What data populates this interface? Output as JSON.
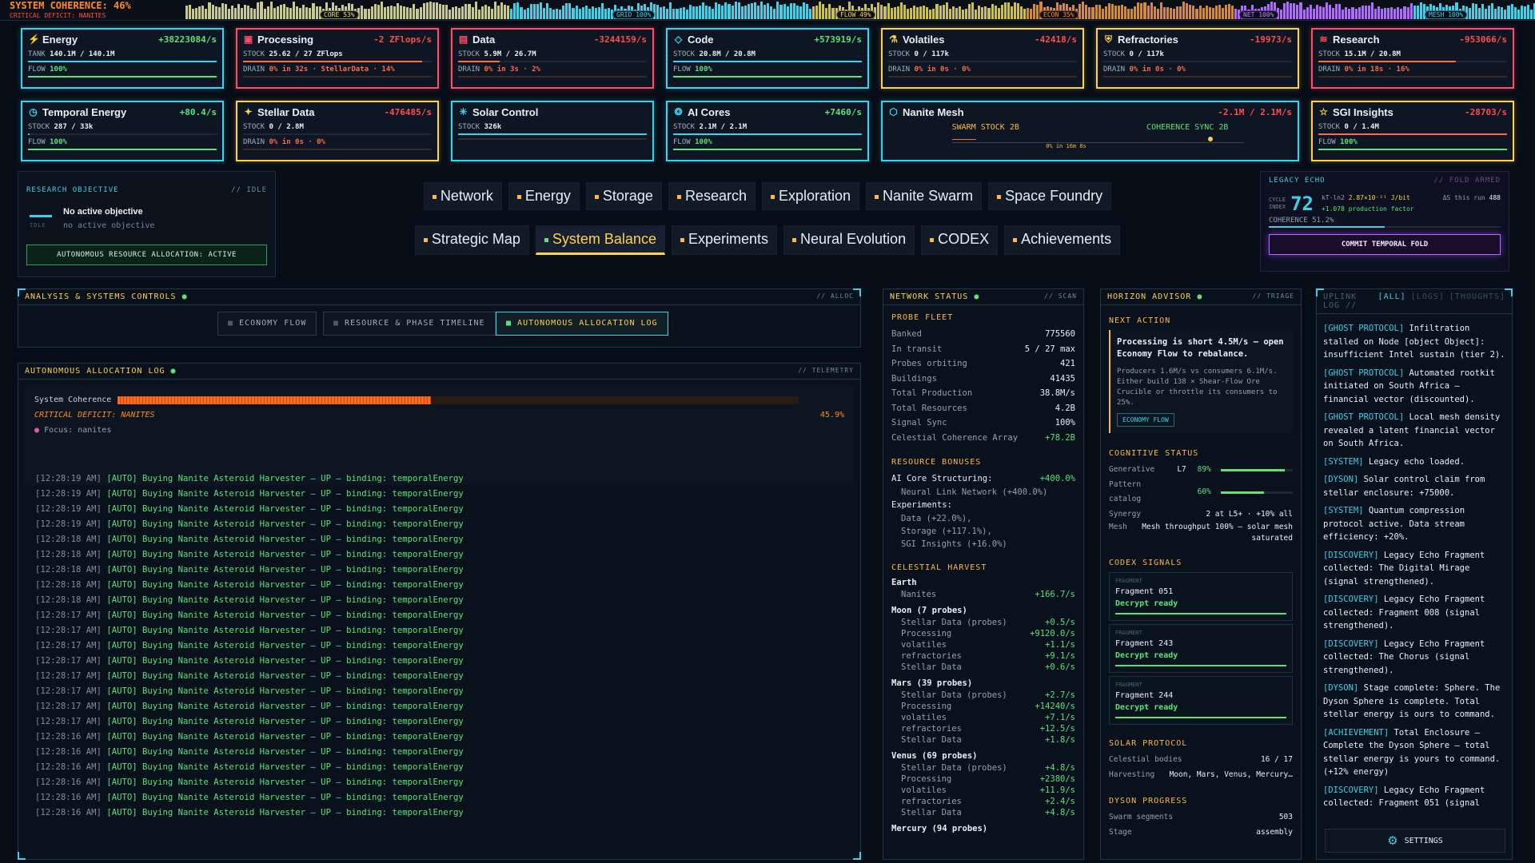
{
  "topbar": {
    "coherence": "SYSTEM COHERENCE: 46%",
    "critical": "CRITICAL DEFICIT: NANITES",
    "segments": [
      "CORE 53%",
      "GRID 100%",
      "FLOW 49%",
      "ECON 35%",
      "NET 100%",
      "MESH 100%"
    ]
  },
  "resources": [
    {
      "name": "Energy",
      "rate": "+38223084/s",
      "line1_k": "TANK",
      "line1_v": "140.1M / 140.1M",
      "line2_k": "FLOW",
      "line2_v": "100%",
      "color": "#33d6f0",
      "rate_color": "#5ee07a",
      "icon": "lightning-icon",
      "fill": 1.0
    },
    {
      "name": "Processing",
      "rate": "-2 ZFlops/s",
      "line1_k": "STOCK",
      "line1_v": "25.62 / 27 ZFlops",
      "line2_k": "DRAIN",
      "line2_v": "0% in 32s · StellarData · 14%",
      "color": "#ff4d6a",
      "rate_color": "#ff4d4d",
      "icon": "chip-icon",
      "fill": 0.95
    },
    {
      "name": "Data",
      "rate": "-3244159/s",
      "line1_k": "STOCK",
      "line1_v": "5.9M / 26.7M",
      "line2_k": "DRAIN",
      "line2_v": "0% in 3s · 2%",
      "color": "#ff4d6a",
      "rate_color": "#ff4d4d",
      "icon": "database-icon",
      "fill": 0.22
    },
    {
      "name": "Code",
      "rate": "+573919/s",
      "line1_k": "STOCK",
      "line1_v": "20.8M / 20.8M",
      "line2_k": "FLOW",
      "line2_v": "100%",
      "color": "#33d6f0",
      "rate_color": "#5ee07a",
      "icon": "code-icon",
      "fill": 1.0
    },
    {
      "name": "Volatiles",
      "rate": "-42418/s",
      "line1_k": "STOCK",
      "line1_v": "0 / 117k",
      "line2_k": "DRAIN",
      "line2_v": "0% in 0s · 0%",
      "color": "#ffd24a",
      "rate_color": "#ff4d4d",
      "icon": "flask-icon",
      "fill": 0.0
    },
    {
      "name": "Refractories",
      "rate": "-19973/s",
      "line1_k": "STOCK",
      "line1_v": "0 / 117k",
      "line2_k": "DRAIN",
      "line2_v": "0% in 0s · 0%",
      "color": "#ffd24a",
      "rate_color": "#ff4d4d",
      "icon": "shield-icon",
      "fill": 0.0
    },
    {
      "name": "Research",
      "rate": "-953066/s",
      "line1_k": "STOCK",
      "line1_v": "15.1M / 20.8M",
      "line2_k": "DRAIN",
      "line2_v": "0% in 18s · 16%",
      "color": "#ff4d6a",
      "rate_color": "#ff4d4d",
      "icon": "layers-icon",
      "fill": 0.73
    },
    {
      "name": "Temporal Energy",
      "rate": "+80.4/s",
      "line1_k": "STOCK",
      "line1_v": "287 / 33k",
      "line2_k": "FLOW",
      "line2_v": "100%",
      "color": "#33d6f0",
      "rate_color": "#5ee07a",
      "icon": "clock-icon",
      "fill": 0.01
    },
    {
      "name": "Stellar Data",
      "rate": "-476485/s",
      "line1_k": "STOCK",
      "line1_v": "0 / 2.8M",
      "line2_k": "DRAIN",
      "line2_v": "0% in 0s · 0%",
      "color": "#ffd24a",
      "rate_color": "#ff4d4d",
      "icon": "star-data-icon",
      "fill": 0.0
    },
    {
      "name": "Solar Control",
      "rate": "",
      "line1_k": "STOCK",
      "line1_v": "326k",
      "line2_k": "",
      "line2_v": "",
      "color": "#33d6f0",
      "rate_color": "#5ee07a",
      "icon": "sun-icon",
      "fill": 1.0
    },
    {
      "name": "AI Cores",
      "rate": "+7460/s",
      "line1_k": "STOCK",
      "line1_v": "2.1M / 2.1M",
      "line2_k": "FLOW",
      "line2_v": "100%",
      "color": "#33d6f0",
      "rate_color": "#5ee07a",
      "icon": "brain-icon",
      "fill": 1.0
    },
    {
      "name": "SGI Insights",
      "rate": "-28703/s",
      "line1_k": "STOCK",
      "line1_v": "0 / 1.4M",
      "line2_k": "FLOW",
      "line2_v": "100%",
      "color": "#ffd24a",
      "rate_color": "#ff4d4d",
      "icon": "star-icon",
      "fill": 1.0
    }
  ],
  "nanite": {
    "name": "Nanite Mesh",
    "rate": "-2.1M / 2.1M/s",
    "swarm": "SWARM STOCK 2B",
    "sync": "COHERENCE SYNC 2B",
    "drain": "0% in 16m 8s"
  },
  "objective": {
    "title": "RESEARCH OBJECTIVE",
    "tag": "// IDLE",
    "main": "No active objective",
    "sub": "no active objective",
    "idle": "IDLE",
    "button": "AUTONOMOUS RESOURCE ALLOCATION: ACTIVE"
  },
  "nav": {
    "row1": [
      "Network",
      "Energy",
      "Storage",
      "Research",
      "Exploration",
      "Nanite Swarm",
      "Space Foundry"
    ],
    "row2": [
      "Strategic Map",
      "System Balance",
      "Experiments",
      "Neural Evolution",
      "CODEX",
      "Achievements"
    ],
    "active": "System Balance"
  },
  "legacy": {
    "title": "LEGACY ECHO",
    "tag": "// FOLD ARMED",
    "cycle_label1": "CYCLE",
    "cycle_label2": "INDEX",
    "index": "72",
    "kt": "kT·ln2",
    "kt_val": "2.87×10⁻²¹ J/bit",
    "prod": "+1.078 production factor",
    "run": "ΔS this run",
    "run_val": "488",
    "coherence": "COHERENCE 51.2%",
    "button": "COMMIT TEMPORAL FOLD"
  },
  "analysis": {
    "title": "ANALYSIS & SYSTEMS CONTROLS",
    "tag": "// ALLOC",
    "tabs": [
      "ECONOMY FLOW",
      "RESOURCE & PHASE TIMELINE",
      "AUTONOMOUS ALLOCATION LOG"
    ]
  },
  "alloclog": {
    "title": "AUTONOMOUS ALLOCATION LOG",
    "tag": "// TELEMETRY",
    "coherence_label": "System Coherence",
    "coherence": 0.46,
    "critical": "CRITICAL DEFICIT: NANITES",
    "pct": "45.9%",
    "focus": "Focus: nanites",
    "entries": [
      [
        "[12:28:19 AM]",
        "[AUTO] Buying Nanite Asteroid Harvester — UP — binding: temporalEnergy"
      ],
      [
        "[12:28:19 AM]",
        "[AUTO] Buying Nanite Asteroid Harvester — UP — binding: temporalEnergy"
      ],
      [
        "[12:28:19 AM]",
        "[AUTO] Buying Nanite Asteroid Harvester — UP — binding: temporalEnergy"
      ],
      [
        "[12:28:19 AM]",
        "[AUTO] Buying Nanite Asteroid Harvester — UP — binding: temporalEnergy"
      ],
      [
        "[12:28:18 AM]",
        "[AUTO] Buying Nanite Asteroid Harvester — UP — binding: temporalEnergy"
      ],
      [
        "[12:28:18 AM]",
        "[AUTO] Buying Nanite Asteroid Harvester — UP — binding: temporalEnergy"
      ],
      [
        "[12:28:18 AM]",
        "[AUTO] Buying Nanite Asteroid Harvester — UP — binding: temporalEnergy"
      ],
      [
        "[12:28:18 AM]",
        "[AUTO] Buying Nanite Asteroid Harvester — UP — binding: temporalEnergy"
      ],
      [
        "[12:28:18 AM]",
        "[AUTO] Buying Nanite Asteroid Harvester — UP — binding: temporalEnergy"
      ],
      [
        "[12:28:17 AM]",
        "[AUTO] Buying Nanite Asteroid Harvester — UP — binding: temporalEnergy"
      ],
      [
        "[12:28:17 AM]",
        "[AUTO] Buying Nanite Asteroid Harvester — UP — binding: temporalEnergy"
      ],
      [
        "[12:28:17 AM]",
        "[AUTO] Buying Nanite Asteroid Harvester — UP — binding: temporalEnergy"
      ],
      [
        "[12:28:17 AM]",
        "[AUTO] Buying Nanite Asteroid Harvester — UP — binding: temporalEnergy"
      ],
      [
        "[12:28:17 AM]",
        "[AUTO] Buying Nanite Asteroid Harvester — UP — binding: temporalEnergy"
      ],
      [
        "[12:28:17 AM]",
        "[AUTO] Buying Nanite Asteroid Harvester — UP — binding: temporalEnergy"
      ],
      [
        "[12:28:17 AM]",
        "[AUTO] Buying Nanite Asteroid Harvester — UP — binding: temporalEnergy"
      ],
      [
        "[12:28:17 AM]",
        "[AUTO] Buying Nanite Asteroid Harvester — UP — binding: temporalEnergy"
      ],
      [
        "[12:28:16 AM]",
        "[AUTO] Buying Nanite Asteroid Harvester — UP — binding: temporalEnergy"
      ],
      [
        "[12:28:16 AM]",
        "[AUTO] Buying Nanite Asteroid Harvester — UP — binding: temporalEnergy"
      ],
      [
        "[12:28:16 AM]",
        "[AUTO] Buying Nanite Asteroid Harvester — UP — binding: temporalEnergy"
      ],
      [
        "[12:28:16 AM]",
        "[AUTO] Buying Nanite Asteroid Harvester — UP — binding: temporalEnergy"
      ],
      [
        "[12:28:16 AM]",
        "[AUTO] Buying Nanite Asteroid Harvester — UP — binding: temporalEnergy"
      ],
      [
        "[12:28:16 AM]",
        "[AUTO] Buying Nanite Asteroid Harvester — UP — binding: temporalEnergy"
      ]
    ]
  },
  "network": {
    "title": "NETWORK STATUS",
    "tag": "// SCAN",
    "fleet_title": "PROBE FLEET",
    "fleet": [
      [
        "Banked",
        "775560"
      ],
      [
        "In transit",
        "5 / 27 max"
      ],
      [
        "Probes orbiting",
        "421"
      ],
      [
        "Buildings",
        "41435"
      ],
      [
        "Total Production",
        "38.8M/s"
      ],
      [
        "Total Resources",
        "4.2B"
      ],
      [
        "Signal Sync",
        "100%"
      ],
      [
        "Celestial Coherence Array",
        "+78.2B"
      ]
    ],
    "bonus_title": "RESOURCE BONUSES",
    "bonus_main": "AI Core Structuring:",
    "bonus_main_v": "+400.0%",
    "bonus_sub": "Neural Link Network (+400.0%)",
    "exp_title": "Experiments:",
    "exps": [
      "Data (+22.0%),",
      "Storage (+117.1%),",
      "SGI Insights (+16.0%)"
    ],
    "harvest_title": "CELESTIAL HARVEST",
    "harvest": [
      {
        "body": "Earth",
        "rows": [
          [
            "Nanites",
            "+166.7/s"
          ]
        ]
      },
      {
        "body": "Moon (7 probes)",
        "rows": [
          [
            "Stellar Data (probes)",
            "+0.5/s"
          ],
          [
            "Processing",
            "+9120.0/s"
          ],
          [
            "volatiles",
            "+1.1/s"
          ],
          [
            "refractories",
            "+9.1/s"
          ],
          [
            "Stellar Data",
            "+0.6/s"
          ]
        ]
      },
      {
        "body": "Mars (39 probes)",
        "rows": [
          [
            "Stellar Data (probes)",
            "+2.7/s"
          ],
          [
            "Processing",
            "+14240/s"
          ],
          [
            "volatiles",
            "+7.1/s"
          ],
          [
            "refractories",
            "+12.5/s"
          ],
          [
            "Stellar Data",
            "+1.8/s"
          ]
        ]
      },
      {
        "body": "Venus (69 probes)",
        "rows": [
          [
            "Stellar Data (probes)",
            "+4.8/s"
          ],
          [
            "Processing",
            "+2380/s"
          ],
          [
            "volatiles",
            "+11.9/s"
          ],
          [
            "refractories",
            "+2.4/s"
          ],
          [
            "Stellar Data",
            "+4.8/s"
          ]
        ]
      },
      {
        "body": "Mercury (94 probes)",
        "rows": []
      }
    ]
  },
  "advisor": {
    "title": "HORIZON ADVISOR",
    "tag": "// TRIAGE",
    "next_title": "NEXT ACTION",
    "next_main": "Processing is short 4.5M/s — open Economy Flow to rebalance.",
    "next_body": "Producers 1.6M/s vs consumers 6.1M/s. Either build 138 × Shear-Flow Ore Crucible or throttle its consumers to 25%.",
    "next_btn": "ECONOMY FLOW",
    "cog_title": "COGNITIVE STATUS",
    "cog": [
      {
        "k": "Generative",
        "m": "L7",
        "v": "89%",
        "f": 0.89
      },
      {
        "k": "Pattern catalog",
        "m": "",
        "v": "60%",
        "f": 0.6
      }
    ],
    "synergy_k": "Synergy",
    "synergy_v": "2 at L5+ · +10% all",
    "mesh_k": "Mesh",
    "mesh_v": "Mesh throughput 100% — solar mesh saturated",
    "codex_title": "CODEX SIGNALS",
    "frags": [
      {
        "label": "FRAGMENT",
        "name": "Fragment 051",
        "status": "Decrypt ready"
      },
      {
        "label": "FRAGMENT",
        "name": "Fragment 243",
        "status": "Decrypt ready"
      },
      {
        "label": "FRAGMENT",
        "name": "Fragment 244",
        "status": "Decrypt ready"
      }
    ],
    "solar_title": "SOLAR PROTOCOL",
    "solar": [
      [
        "Celestial bodies",
        "16 / 17"
      ],
      [
        "Harvesting",
        "Moon, Mars, Venus, Mercury…"
      ]
    ],
    "dyson_title": "DYSON PROGRESS",
    "dyson": [
      [
        "Swarm segments",
        "503"
      ],
      [
        "Stage",
        "assembly"
      ]
    ]
  },
  "uplink": {
    "title": "UPLINK LOG //",
    "filters": [
      "[ALL]",
      "[LOGS]",
      "[THOUGHTS]"
    ],
    "settings": "SETTINGS",
    "entries": [
      [
        "[GHOST PROTOCOL]",
        "Infiltration stalled on Node [object Object]: insufficient Intel sustain (tier 2)."
      ],
      [
        "[GHOST PROTOCOL]",
        "Automated rootkit initiated on South Africa — financial vector (discounted)."
      ],
      [
        "[GHOST PROTOCOL]",
        "Local mesh density revealed a latent financial vector on South Africa."
      ],
      [
        "[SYSTEM]",
        "Legacy echo loaded."
      ],
      [
        "[DYSON]",
        "Solar control claim from stellar enclosure: +75000."
      ],
      [
        "[SYSTEM]",
        "Quantum compression protocol active. Data stream efficiency: +20%."
      ],
      [
        "[DISCOVERY]",
        "Legacy Echo Fragment collected: The Digital Mirage (signal strengthened)."
      ],
      [
        "[DISCOVERY]",
        "Legacy Echo Fragment collected: Fragment 008 (signal strengthened)."
      ],
      [
        "[DISCOVERY]",
        "Legacy Echo Fragment collected: The Chorus (signal strengthened)."
      ],
      [
        "[DYSON]",
        "Stage complete: Sphere. The Dyson Sphere is complete. Total stellar energy is ours to command."
      ],
      [
        "[ACHIEVEMENT]",
        "Total Enclosure — Complete the Dyson Sphere — total stellar energy is yours to command. (+12% energy)"
      ],
      [
        "[DISCOVERY]",
        "Legacy Echo Fragment collected: Fragment 051 (signal"
      ]
    ]
  }
}
